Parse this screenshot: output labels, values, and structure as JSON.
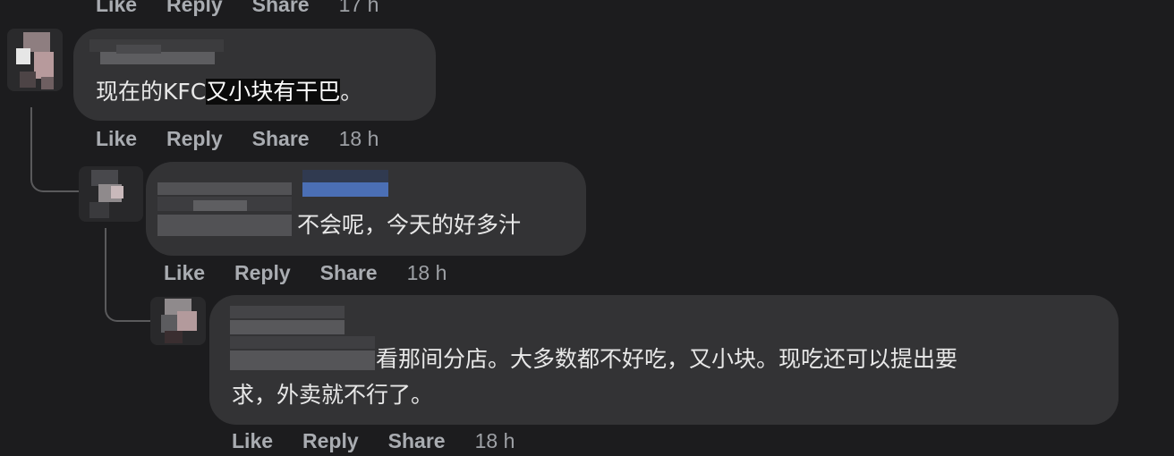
{
  "comments": [
    {
      "author": "",
      "text_plain": "现在的KFC",
      "text_highlight": "又小块有干巴",
      "text_tail": "。",
      "actions": {
        "like": "Like",
        "reply": "Reply",
        "share": "Share",
        "time": "18 h"
      }
    },
    {
      "author": "",
      "mention": "",
      "text": "不会呢，今天的好多汁",
      "actions": {
        "like": "Like",
        "reply": "Reply",
        "share": "Share",
        "time": "18 h"
      }
    },
    {
      "author": "",
      "text_line1": "看那间分店。大多数都不好吃，又小块。现吃还可以提出要",
      "text_line2": "求，外卖就不行了。",
      "actions": {
        "like": "Like",
        "reply": "Reply",
        "share": "Share",
        "time": "18 h"
      }
    }
  ],
  "previous_actions": {
    "like": "Like",
    "reply": "Reply",
    "share": "Share",
    "time": "17 h"
  },
  "colors": {
    "background": "#1c1c1e",
    "bubble": "#333335",
    "action_text": "#a9acb1",
    "mention_blue": "#4b6fb5"
  }
}
